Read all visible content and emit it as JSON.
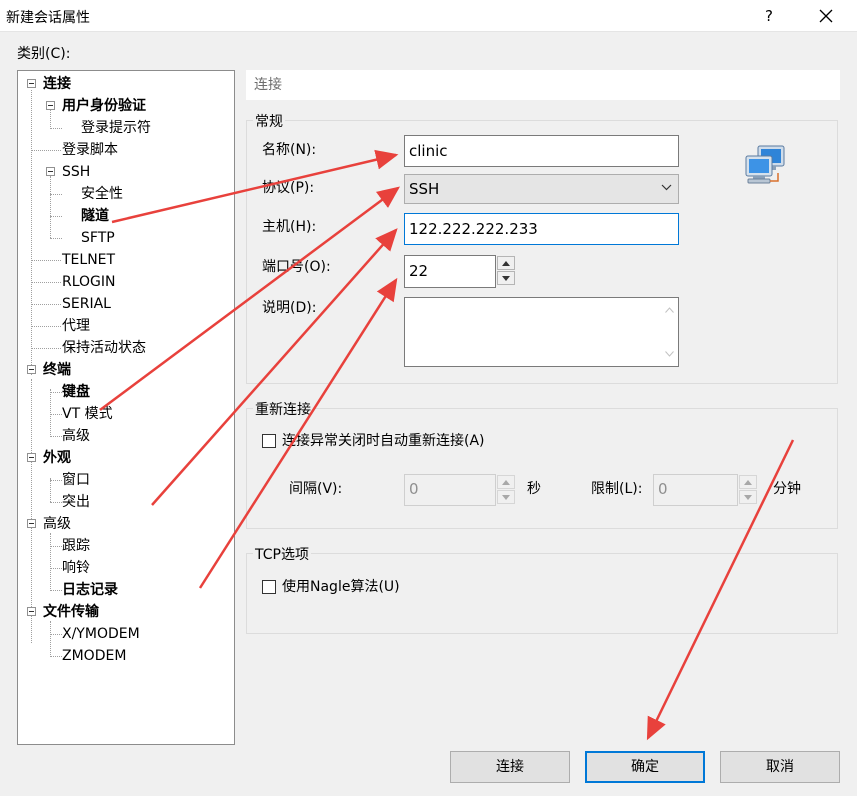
{
  "window": {
    "title": "新建会话属性",
    "help_label": "?"
  },
  "category": {
    "label": "类别(C):",
    "tree": [
      {
        "label": "连接",
        "bold": true
      },
      {
        "label": "用户身份验证",
        "bold": true
      },
      {
        "label": "登录提示符",
        "bold": false
      },
      {
        "label": "登录脚本",
        "bold": false
      },
      {
        "label": "SSH",
        "bold": false
      },
      {
        "label": "安全性",
        "bold": false
      },
      {
        "label": "隧道",
        "bold": true
      },
      {
        "label": "SFTP",
        "bold": false
      },
      {
        "label": "TELNET",
        "bold": false
      },
      {
        "label": "RLOGIN",
        "bold": false
      },
      {
        "label": "SERIAL",
        "bold": false
      },
      {
        "label": "代理",
        "bold": false
      },
      {
        "label": "保持活动状态",
        "bold": false
      },
      {
        "label": "终端",
        "bold": true
      },
      {
        "label": "键盘",
        "bold": true
      },
      {
        "label": "VT 模式",
        "bold": false
      },
      {
        "label": "高级",
        "bold": false
      },
      {
        "label": "外观",
        "bold": true
      },
      {
        "label": "窗口",
        "bold": false
      },
      {
        "label": "突出",
        "bold": false
      },
      {
        "label": "高级",
        "bold": false
      },
      {
        "label": "跟踪",
        "bold": false
      },
      {
        "label": "响铃",
        "bold": false
      },
      {
        "label": "日志记录",
        "bold": true
      },
      {
        "label": "文件传输",
        "bold": true
      },
      {
        "label": "X/YMODEM",
        "bold": false
      },
      {
        "label": "ZMODEM",
        "bold": false
      }
    ]
  },
  "panel": {
    "header": "连接",
    "general": {
      "title": "常规",
      "name_label": "名称(N):",
      "name_value": "clinic",
      "protocol_label": "协议(P):",
      "protocol_value": "SSH",
      "host_label": "主机(H):",
      "host_value": "122.222.222.233",
      "port_label": "端口号(O):",
      "port_value": "22",
      "desc_label": "说明(D):",
      "desc_value": ""
    },
    "reconnect": {
      "title": "重新连接",
      "auto_label": "连接异常关闭时自动重新连接(A)",
      "interval_label": "间隔(V):",
      "interval_value": "0",
      "interval_unit": "秒",
      "limit_label": "限制(L):",
      "limit_value": "0",
      "limit_unit": "分钟"
    },
    "tcp": {
      "title": "TCP选项",
      "nagle_label": "使用Nagle算法(U)"
    }
  },
  "buttons": {
    "connect": "连接",
    "ok": "确定",
    "cancel": "取消"
  },
  "colors": {
    "focus": "#0078d7",
    "annotation_arrow": "#e8413c"
  }
}
